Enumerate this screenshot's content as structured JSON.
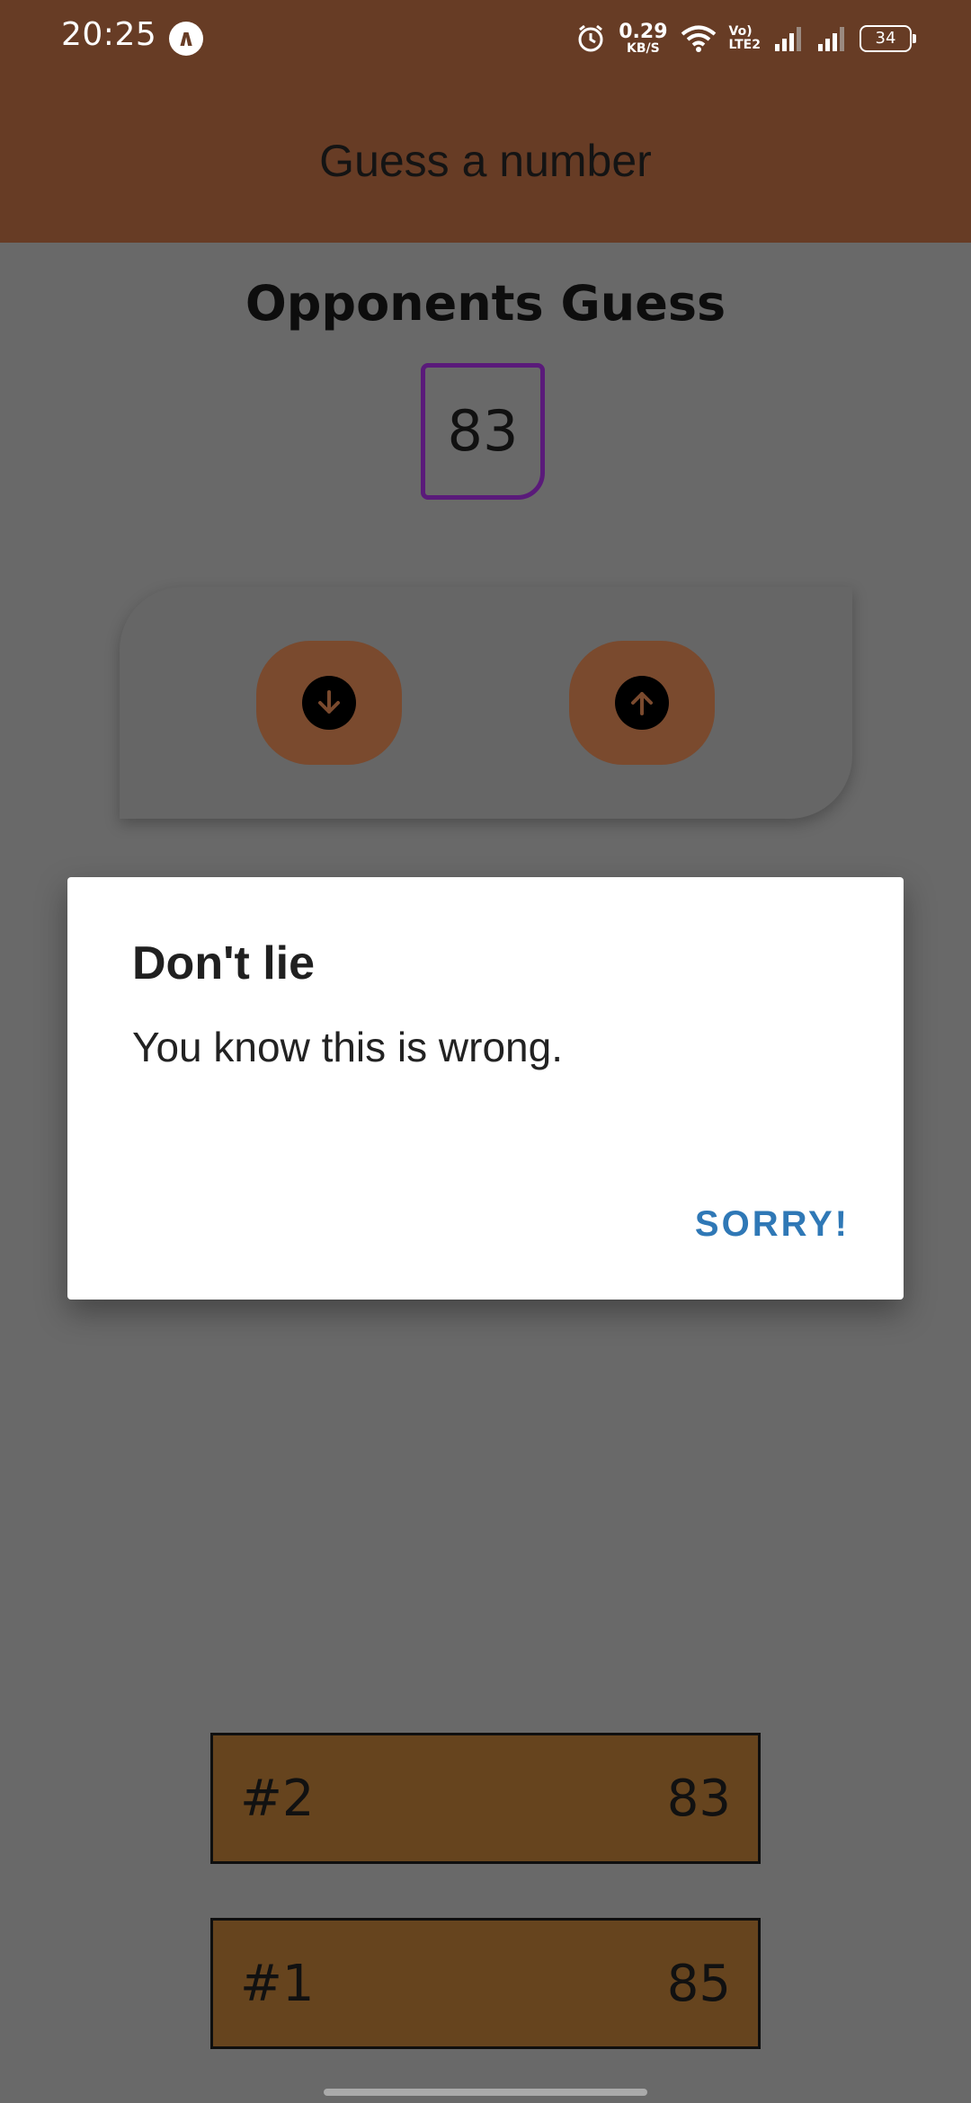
{
  "status_bar": {
    "time": "20:25",
    "app_icon": "arrow-logo",
    "net_speed_value": "0.29",
    "net_speed_unit": "KB/S",
    "volte_line1": "Vo)",
    "volte_line2": "LTE2",
    "battery": "34",
    "icons": [
      "alarm-icon",
      "wifi-icon",
      "signal-icon",
      "signal-icon",
      "battery-icon"
    ]
  },
  "header": {
    "title": "Guess a number"
  },
  "game": {
    "section_title": "Opponents Guess",
    "current_guess": "83",
    "buttons": [
      {
        "name": "lower",
        "icon": "arrow-down-icon"
      },
      {
        "name": "higher",
        "icon": "arrow-up-icon"
      }
    ]
  },
  "dialog": {
    "title": "Don't lie",
    "message": "You know this is wrong.",
    "action_label": "SORRY!"
  },
  "log": [
    {
      "round": "#2",
      "value": "83"
    },
    {
      "round": "#1",
      "value": "85"
    }
  ],
  "colors": {
    "header_bg": "#673c25",
    "button_bg": "#7a4a2e",
    "log_bg": "#66441e",
    "guess_border": "#5a1a7a",
    "dialog_action": "#2f78b6"
  }
}
